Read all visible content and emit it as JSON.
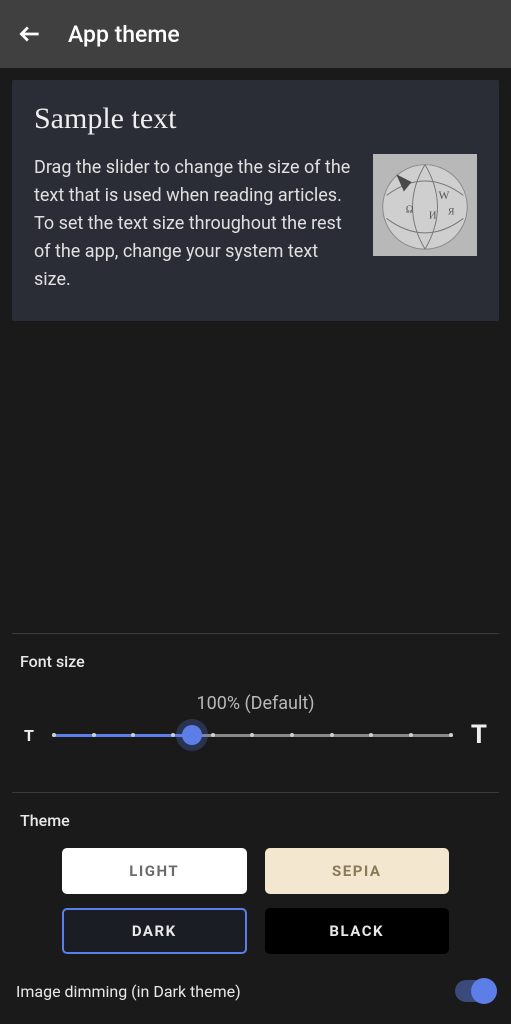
{
  "header": {
    "title": "App theme"
  },
  "sample": {
    "heading": "Sample text",
    "body": "Drag the slider to change the size of the text that is used when reading articles. To set the text size throughout the rest of the app, change your system text size."
  },
  "font_size": {
    "label": "Font size",
    "caption": "100% (Default)",
    "min_glyph": "T",
    "max_glyph": "T",
    "value_percent": 35
  },
  "theme": {
    "label": "Theme",
    "options": {
      "light": "LIGHT",
      "sepia": "SEPIA",
      "dark": "DARK",
      "black": "BLACK"
    },
    "selected": "dark"
  },
  "dimming": {
    "label": "Image dimming (in Dark theme)",
    "enabled": true
  },
  "colors": {
    "accent": "#5d7ee9",
    "bg": "#1a1a1a",
    "card": "#2a2d36",
    "header": "#404040"
  }
}
